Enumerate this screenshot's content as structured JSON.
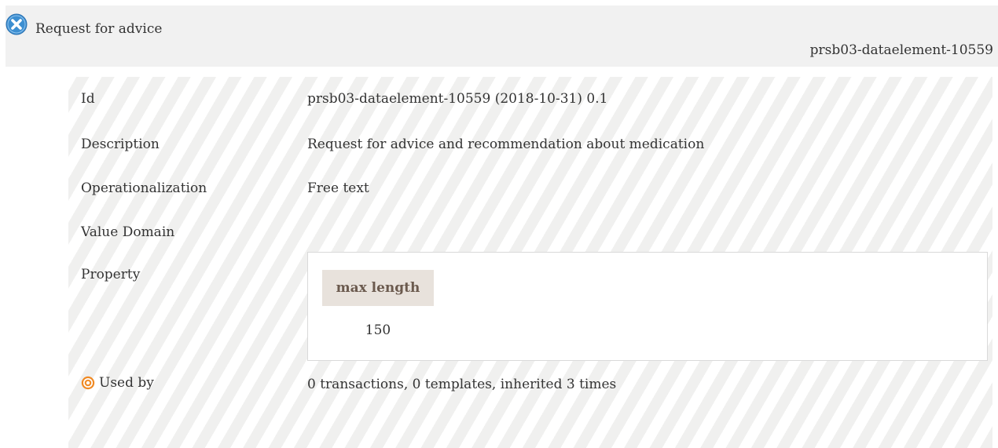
{
  "header": {
    "title": "Request for advice",
    "id": "prsb03-dataelement-10559"
  },
  "rows": {
    "id": {
      "label": "Id",
      "value": "prsb03-dataelement-10559 (2018-10-31) 0.1"
    },
    "description": {
      "label": "Description",
      "value": "Request for advice and recommendation about medication"
    },
    "operationalization": {
      "label": "Operationalization",
      "value": "Free text"
    },
    "value_domain": {
      "label": "Value Domain"
    },
    "property": {
      "label": "Property",
      "column_header": "max length",
      "column_value": "150"
    },
    "used_by": {
      "label": "Used by",
      "value": "0 transactions, 0 templates, inherited 3 times"
    }
  },
  "colors": {
    "header_bg": "#f1f1f1",
    "stripe": "#f0f0ef",
    "property_header_bg": "#e8e2dc",
    "property_header_text": "#6b5a4e",
    "close_icon": "#3d8fd1",
    "used_by_icon": "#f08a24"
  },
  "icons": {
    "close": "close-circle-icon",
    "used_by": "target-icon"
  }
}
